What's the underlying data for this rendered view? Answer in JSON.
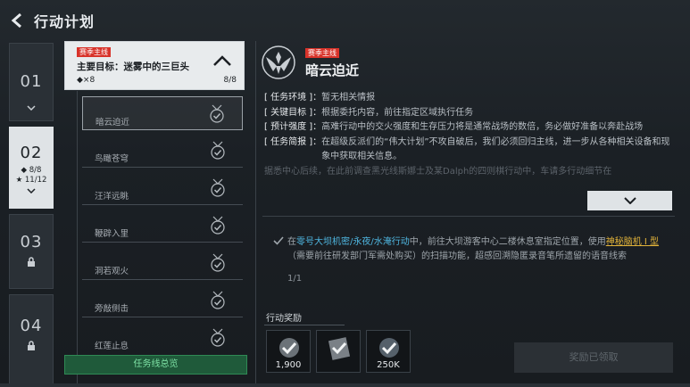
{
  "header": {
    "title": "行动计划"
  },
  "chapters": [
    {
      "num": "01",
      "state": "normal"
    },
    {
      "num": "02",
      "state": "active",
      "stat1": "◆ 8/8",
      "stat2": "★ 11/12"
    },
    {
      "num": "03",
      "state": "locked"
    },
    {
      "num": "04",
      "state": "locked"
    }
  ],
  "main_mission": {
    "tag": "赛季主线",
    "title": "主要目标：迷雾中的三巨头",
    "count": "◆×8",
    "progress": "8/8"
  },
  "sub_missions": [
    {
      "label": "暗云迫近"
    },
    {
      "label": "鸟瞰苍穹"
    },
    {
      "label": "汪洋远眺"
    },
    {
      "label": "鞭辟入里"
    },
    {
      "label": "洞若观火"
    },
    {
      "label": "旁敲侧击"
    },
    {
      "label": "红莲止息"
    }
  ],
  "overview_button": "任务线总览",
  "detail": {
    "tag": "赛季主线",
    "title": "暗云迫近",
    "brief": [
      {
        "key": "[ 任务环境 ]：",
        "value": "暂无相关情报"
      },
      {
        "key": "[ 关键目标 ]：",
        "value": "根据委托内容，前往指定区域执行任务"
      },
      {
        "key": "[ 预计强度 ]：",
        "value": "高难行动中的交火强度和生存压力将是通常战场的数倍，务必做好准备以奔赴战场"
      },
      {
        "key": "[ 任务简报 ]：",
        "value": "在超级反派们的“伟大计划”不攻自破后，我们必须回归主线，进一步从各种相关设备和现象中获取相关信息。"
      }
    ],
    "brief_faded": "据悉中心后续，在此前调查黑光线斯娜士及某Dalph的四则棋行动中，车请多行动细节在",
    "task": {
      "prefix": "在",
      "highlight1": "零号大坝机密/永夜/水淹行动",
      "mid1": "中，前往大坝游客中心二楼休息室指定位置，使用",
      "highlight2": "神秘脑机 I 型",
      "mid2": "（需要前往研发部门军需处购买）的扫描功能，超感回溯隐匿录音笔所遗留的语音线索",
      "progress": "1/1"
    },
    "rewards_label": "行动奖励",
    "rewards": [
      {
        "icon": "check-badge-icon",
        "value": "1,900"
      },
      {
        "icon": "check-badge-icon",
        "value": ""
      },
      {
        "icon": "check-badge-icon",
        "value": "250K"
      }
    ],
    "claimed_button": "奖励已领取"
  }
}
